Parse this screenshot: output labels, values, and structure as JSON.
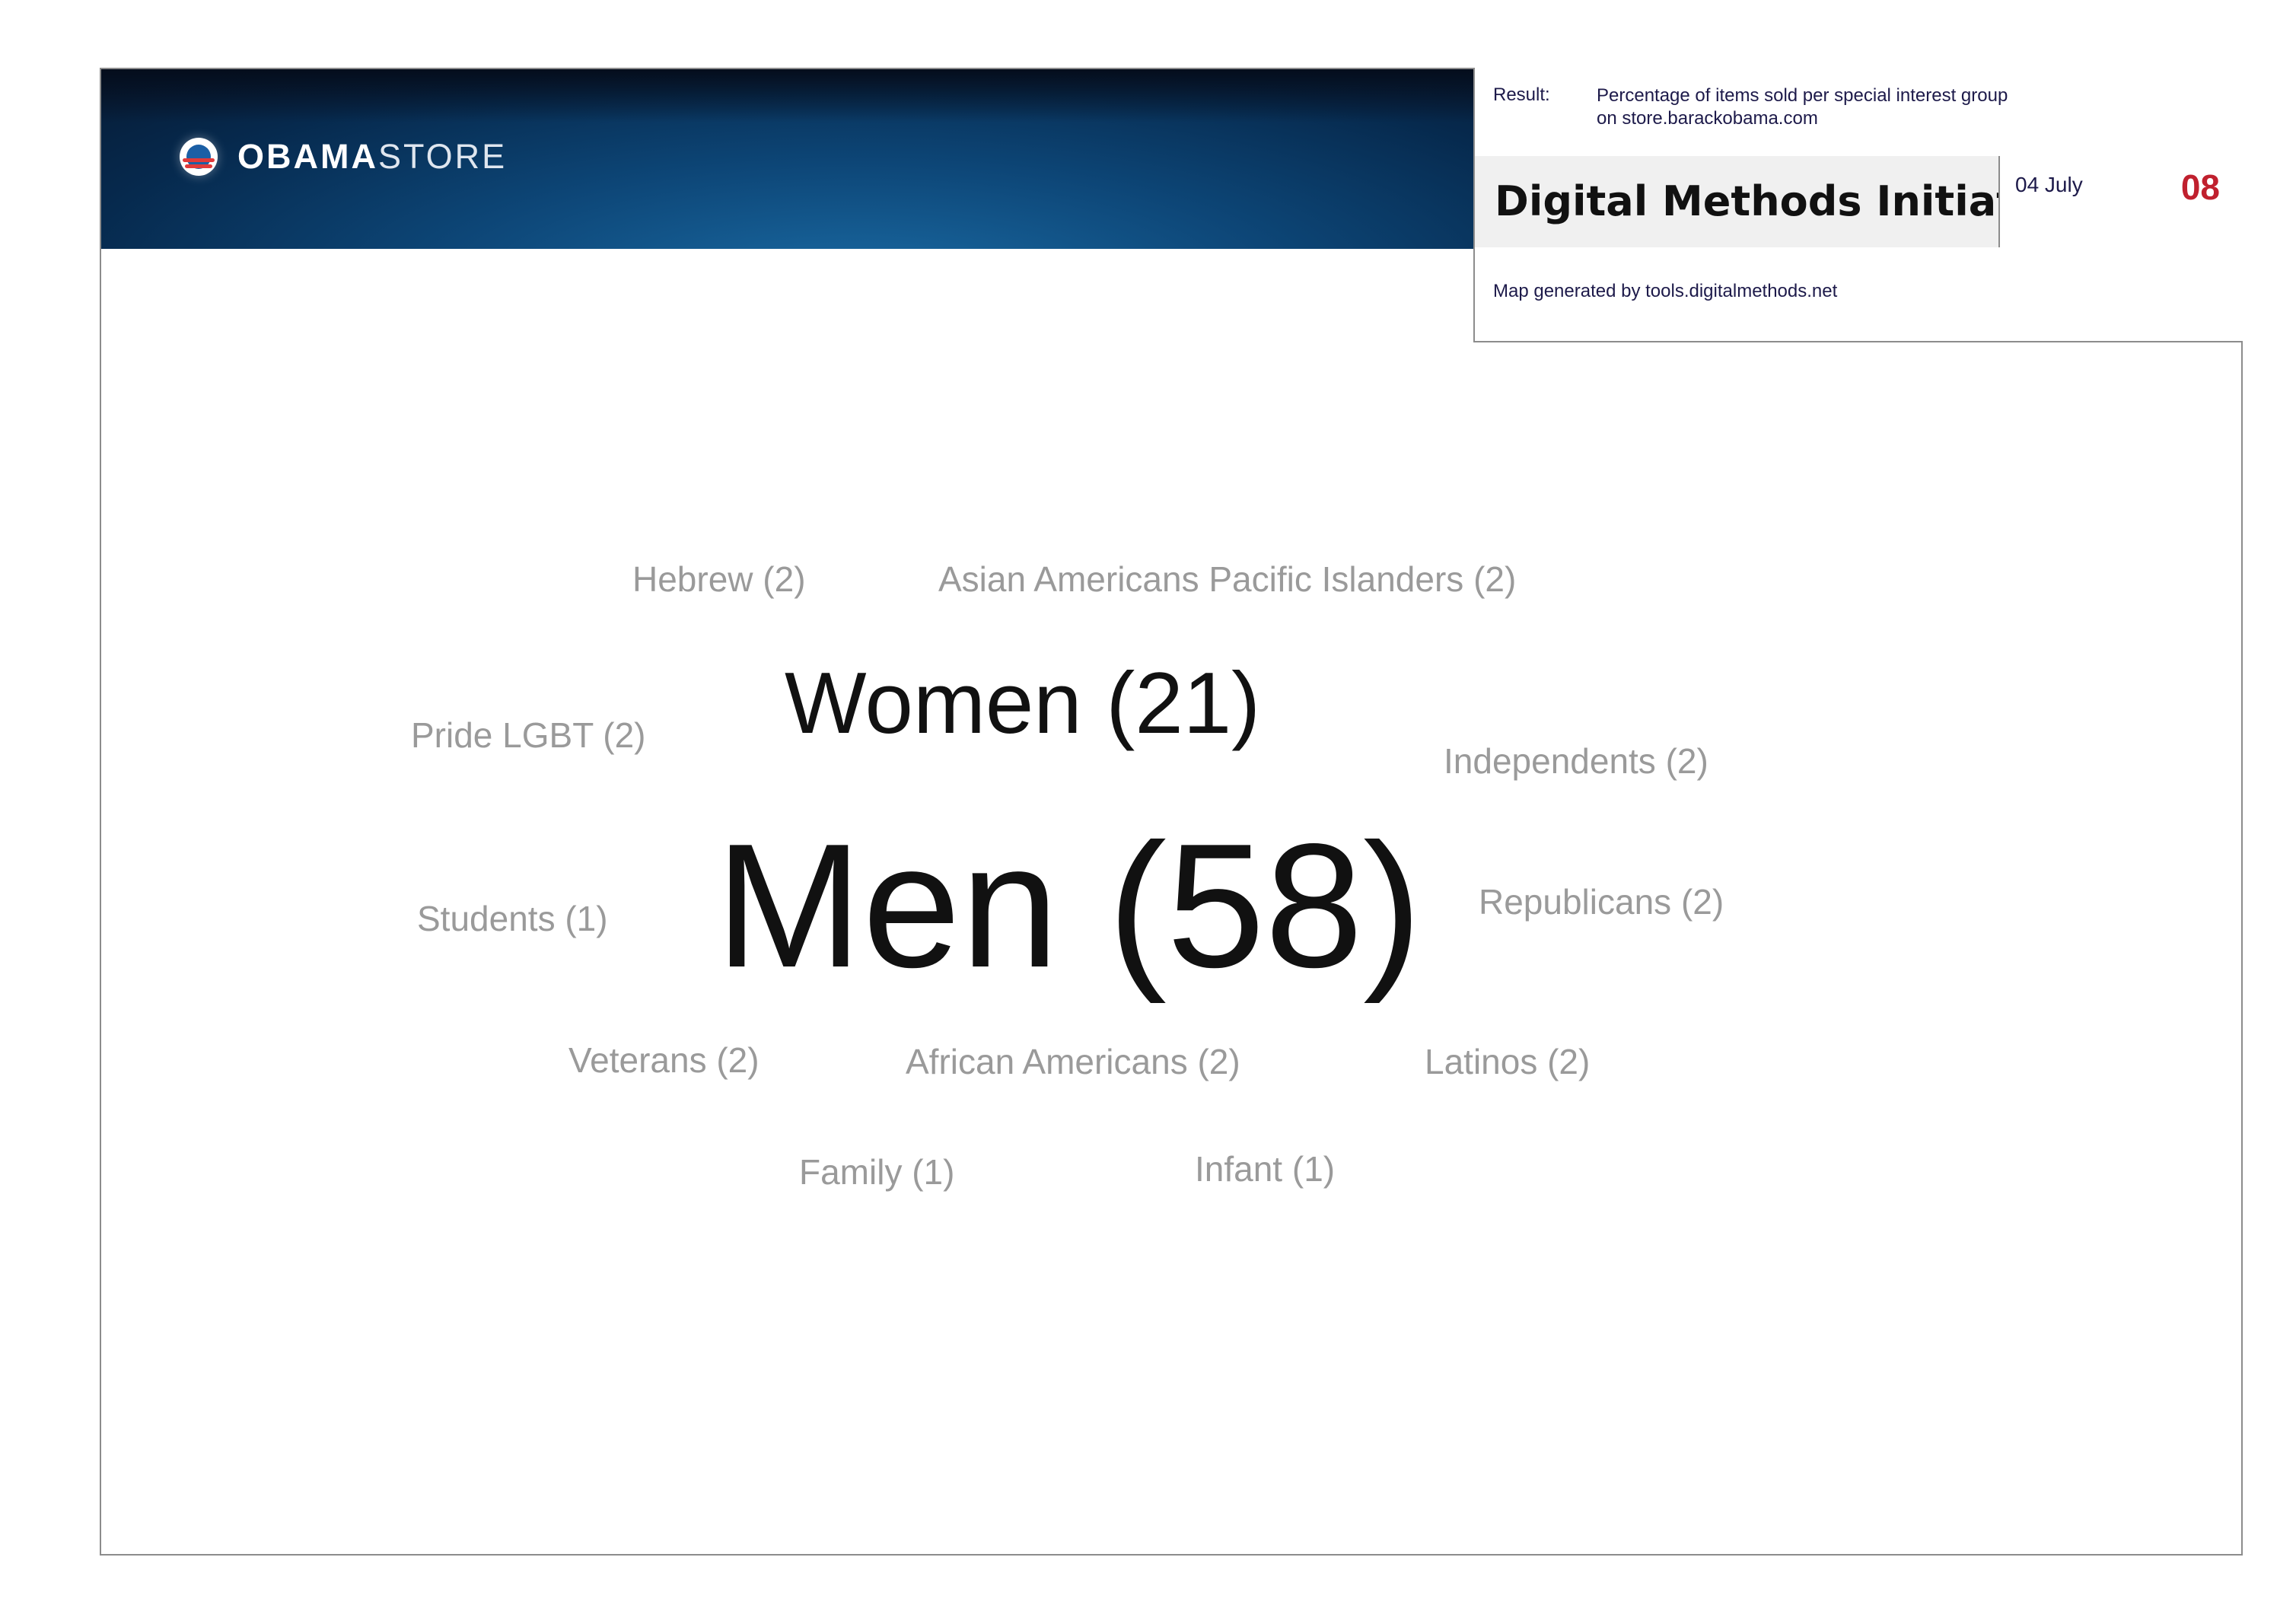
{
  "header": {
    "logo": {
      "icon": "obama-logo-icon",
      "brand_bold": "OBAMA",
      "brand_light": "STORE"
    }
  },
  "info_box": {
    "result_label": "Result:",
    "result_line1": "Percentage of items sold per special interest group",
    "result_line2": "on store.barackobama.com",
    "title": "Digital Methods Initiative",
    "date": "04 July",
    "number": "08",
    "map_generated": "Map generated by tools.digitalmethods.net"
  },
  "tag_cloud": [
    {
      "label": "Hebrew (2)"
    },
    {
      "label": "Asian Americans Pacific Islanders (2)"
    },
    {
      "label": "Women (21)"
    },
    {
      "label": "Pride LGBT (2)"
    },
    {
      "label": "Independents (2)"
    },
    {
      "label": "Men (58)"
    },
    {
      "label": "Students (1)"
    },
    {
      "label": "Republicans (2)"
    },
    {
      "label": "Veterans (2)"
    },
    {
      "label": "African Americans (2)"
    },
    {
      "label": "Latinos (2)"
    },
    {
      "label": "Family (1)"
    },
    {
      "label": "Infant (1)"
    }
  ],
  "colors": {
    "accent_number": "#c0202e",
    "minor_words": "#9a9a9a",
    "major_words": "#111111",
    "banner": "#0d4677"
  }
}
